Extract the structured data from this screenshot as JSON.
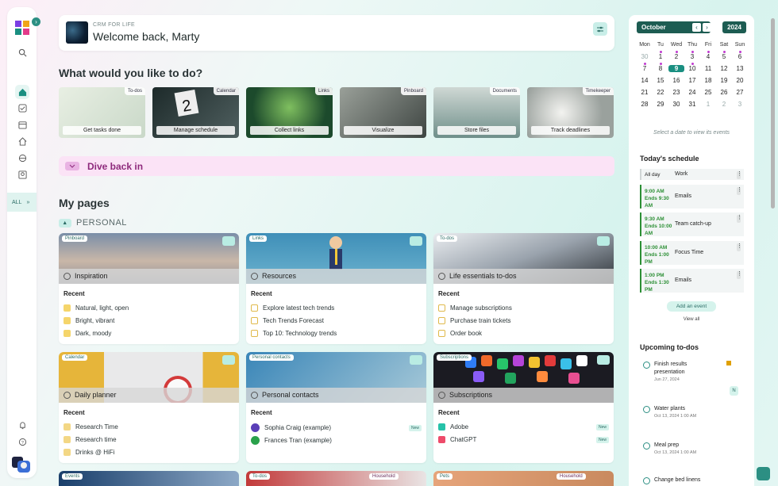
{
  "app": {
    "subtitle": "CRM FOR LIFE",
    "welcome": "Welcome back,",
    "user": "Marty"
  },
  "rail": {
    "all_label": "ALL"
  },
  "quick": {
    "title": "What would you like to do?",
    "tiles": [
      {
        "tag": "To-dos",
        "label": "Get tasks done"
      },
      {
        "tag": "Calendar",
        "label": "Manage schedule"
      },
      {
        "tag": "Links",
        "label": "Collect links"
      },
      {
        "tag": "Pinboard",
        "label": "Visualize"
      },
      {
        "tag": "Documents",
        "label": "Store files"
      },
      {
        "tag": "Timekeeper",
        "label": "Track deadlines"
      }
    ]
  },
  "dive": {
    "label": "Dive back in"
  },
  "pages": {
    "title": "My pages",
    "section": "PERSONAL",
    "recent": "Recent",
    "cards": [
      {
        "tag": "Pinboard",
        "title": "Inspiration",
        "items": [
          "Natural, light, open",
          "Bright, vibrant",
          "Dark, moody"
        ]
      },
      {
        "tag": "Links",
        "title": "Resources",
        "items": [
          "Explore latest tech trends",
          "Tech Trends Forecast",
          "Top 10: Technology trends"
        ]
      },
      {
        "tag": "To-dos",
        "title": "Life essentials to-dos",
        "items": [
          "Manage subscriptions",
          "Purchase train tickets",
          "Order book"
        ]
      },
      {
        "tag": "Calendar",
        "title": "Daily planner",
        "items": [
          "Research Time",
          "Research time",
          "Drinks @ HiFi"
        ]
      },
      {
        "tag": "Personal contacts",
        "title": "Personal contacts",
        "items": [
          "Sophia Craig (example)",
          "Frances Tran (example)"
        ],
        "badges": [
          "New",
          ""
        ]
      },
      {
        "tag": "Subscriptions",
        "title": "Subscriptions",
        "items": [
          "Adobe",
          "ChatGPT"
        ],
        "badges": [
          "New",
          "New"
        ]
      }
    ],
    "row3_tags": [
      "Events",
      "To-dos",
      "Household",
      "Pets",
      "Household"
    ]
  },
  "calendar": {
    "month": "October",
    "year": "2024",
    "dow": [
      "Mon",
      "Tu",
      "Wed",
      "Thu",
      "Fri",
      "Sat",
      "Sun"
    ],
    "weeks": [
      [
        "30",
        "1",
        "2",
        "3",
        "4",
        "5",
        "6"
      ],
      [
        "7",
        "8",
        "9",
        "10",
        "11",
        "12",
        "13"
      ],
      [
        "14",
        "15",
        "16",
        "17",
        "18",
        "19",
        "20"
      ],
      [
        "21",
        "22",
        "23",
        "24",
        "25",
        "26",
        "27"
      ],
      [
        "28",
        "29",
        "30",
        "31",
        "1",
        "2",
        "3"
      ]
    ],
    "selected": "9",
    "hint": "Select a date to view its events"
  },
  "schedule": {
    "title": "Today's schedule",
    "items": [
      {
        "time": "All day",
        "name": "Work"
      },
      {
        "time": "9:00 AM Ends 9:30 AM",
        "name": "Emails"
      },
      {
        "time": "9:30 AM Ends 10:00 AM",
        "name": "Team catch-up"
      },
      {
        "time": "10:00 AM Ends 1:00 PM",
        "name": "Focus Time"
      },
      {
        "time": "1:00 PM Ends 1:30 PM",
        "name": "Emails"
      }
    ],
    "add": "Add an event",
    "view_all": "View all"
  },
  "todos": {
    "title": "Upcoming to-dos",
    "items": [
      {
        "title": "Finish results presentation",
        "date": "Jun 27, 2024"
      },
      {
        "title": "Water plants",
        "date": "Oct 13, 2024 1:00 AM"
      },
      {
        "title": "Meal prep",
        "date": "Oct 13, 2024 1:00 AM"
      },
      {
        "title": "Change bed linens",
        "date": ""
      }
    ]
  }
}
